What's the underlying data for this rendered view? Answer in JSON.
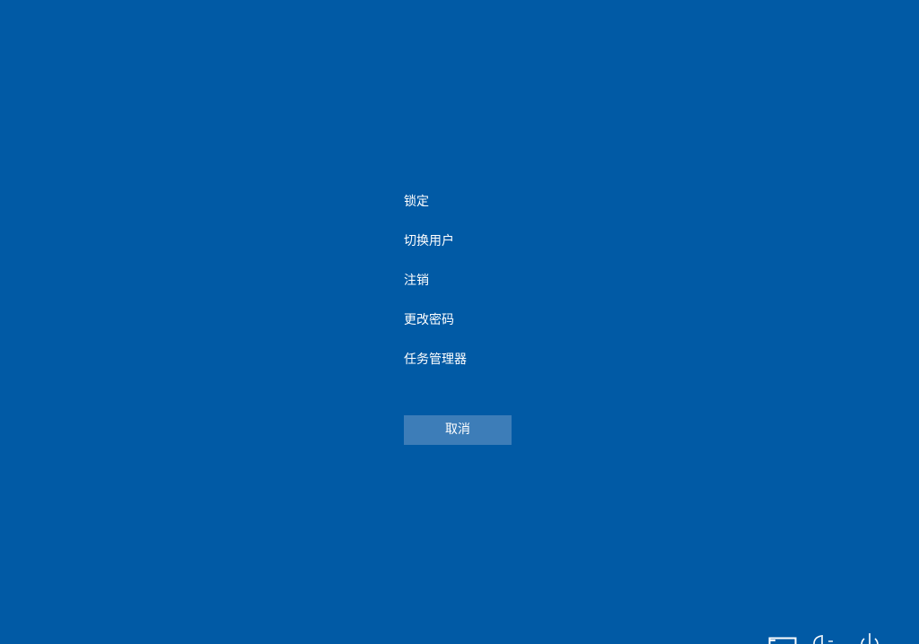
{
  "screen": {
    "background_color": "#015aa5"
  },
  "menu": {
    "items": [
      {
        "label": "锁定",
        "name": "lock"
      },
      {
        "label": "切换用户",
        "name": "switch-user"
      },
      {
        "label": "注销",
        "name": "sign-out"
      },
      {
        "label": "更改密码",
        "name": "change-password"
      },
      {
        "label": "任务管理器",
        "name": "task-manager"
      }
    ]
  },
  "cancel_button": {
    "label": "取消",
    "color": "#3d7db8"
  },
  "tray": {
    "icons": [
      "network-icon",
      "accessibility-icon",
      "power-icon"
    ]
  }
}
